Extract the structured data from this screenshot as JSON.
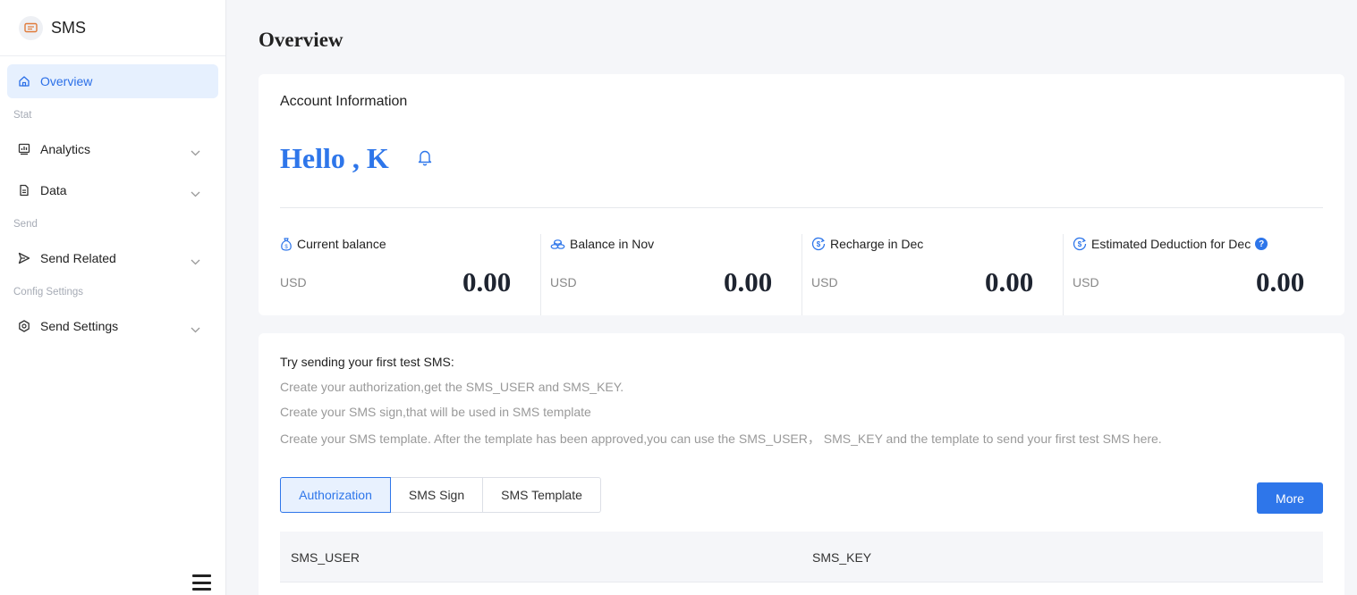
{
  "sidebar": {
    "brand": "SMS",
    "items": {
      "overview": "Overview",
      "stat_section": "Stat",
      "analytics": "Analytics",
      "data": "Data",
      "send_section": "Send",
      "send_related": "Send Related",
      "config_section": "Config Settings",
      "send_settings": "Send Settings"
    }
  },
  "page": {
    "title": "Overview"
  },
  "account": {
    "title": "Account Information",
    "greeting": "Hello , K",
    "stats": [
      {
        "label": "Current balance",
        "unit": "USD",
        "value": "0.00",
        "icon": "money-bag-icon"
      },
      {
        "label": "Balance in Nov",
        "unit": "USD",
        "value": "0.00",
        "icon": "coins-icon"
      },
      {
        "label": "Recharge in Dec",
        "unit": "USD",
        "value": "0.00",
        "icon": "dollar-circle-icon"
      },
      {
        "label": "Estimated Deduction for Dec",
        "unit": "USD",
        "value": "0.00",
        "icon": "dollar-circle-icon"
      }
    ],
    "help_glyph": "?"
  },
  "guide": {
    "title": "Try sending your first test SMS:",
    "lines": [
      "Create your authorization,get the SMS_USER and SMS_KEY.",
      "Create your SMS sign,that will be used in SMS template",
      "Create your SMS template. After the template has been approved,you can use the SMS_USER， SMS_KEY and the template to send your first test SMS here."
    ],
    "tabs": [
      "Authorization",
      "SMS Sign",
      "SMS Template"
    ],
    "more": "More",
    "columns": [
      "SMS_USER",
      "SMS_KEY"
    ]
  },
  "colors": {
    "accent": "#2e76ea",
    "active_bg": "#e6f0fe",
    "page_bg": "#f5f6f9"
  }
}
